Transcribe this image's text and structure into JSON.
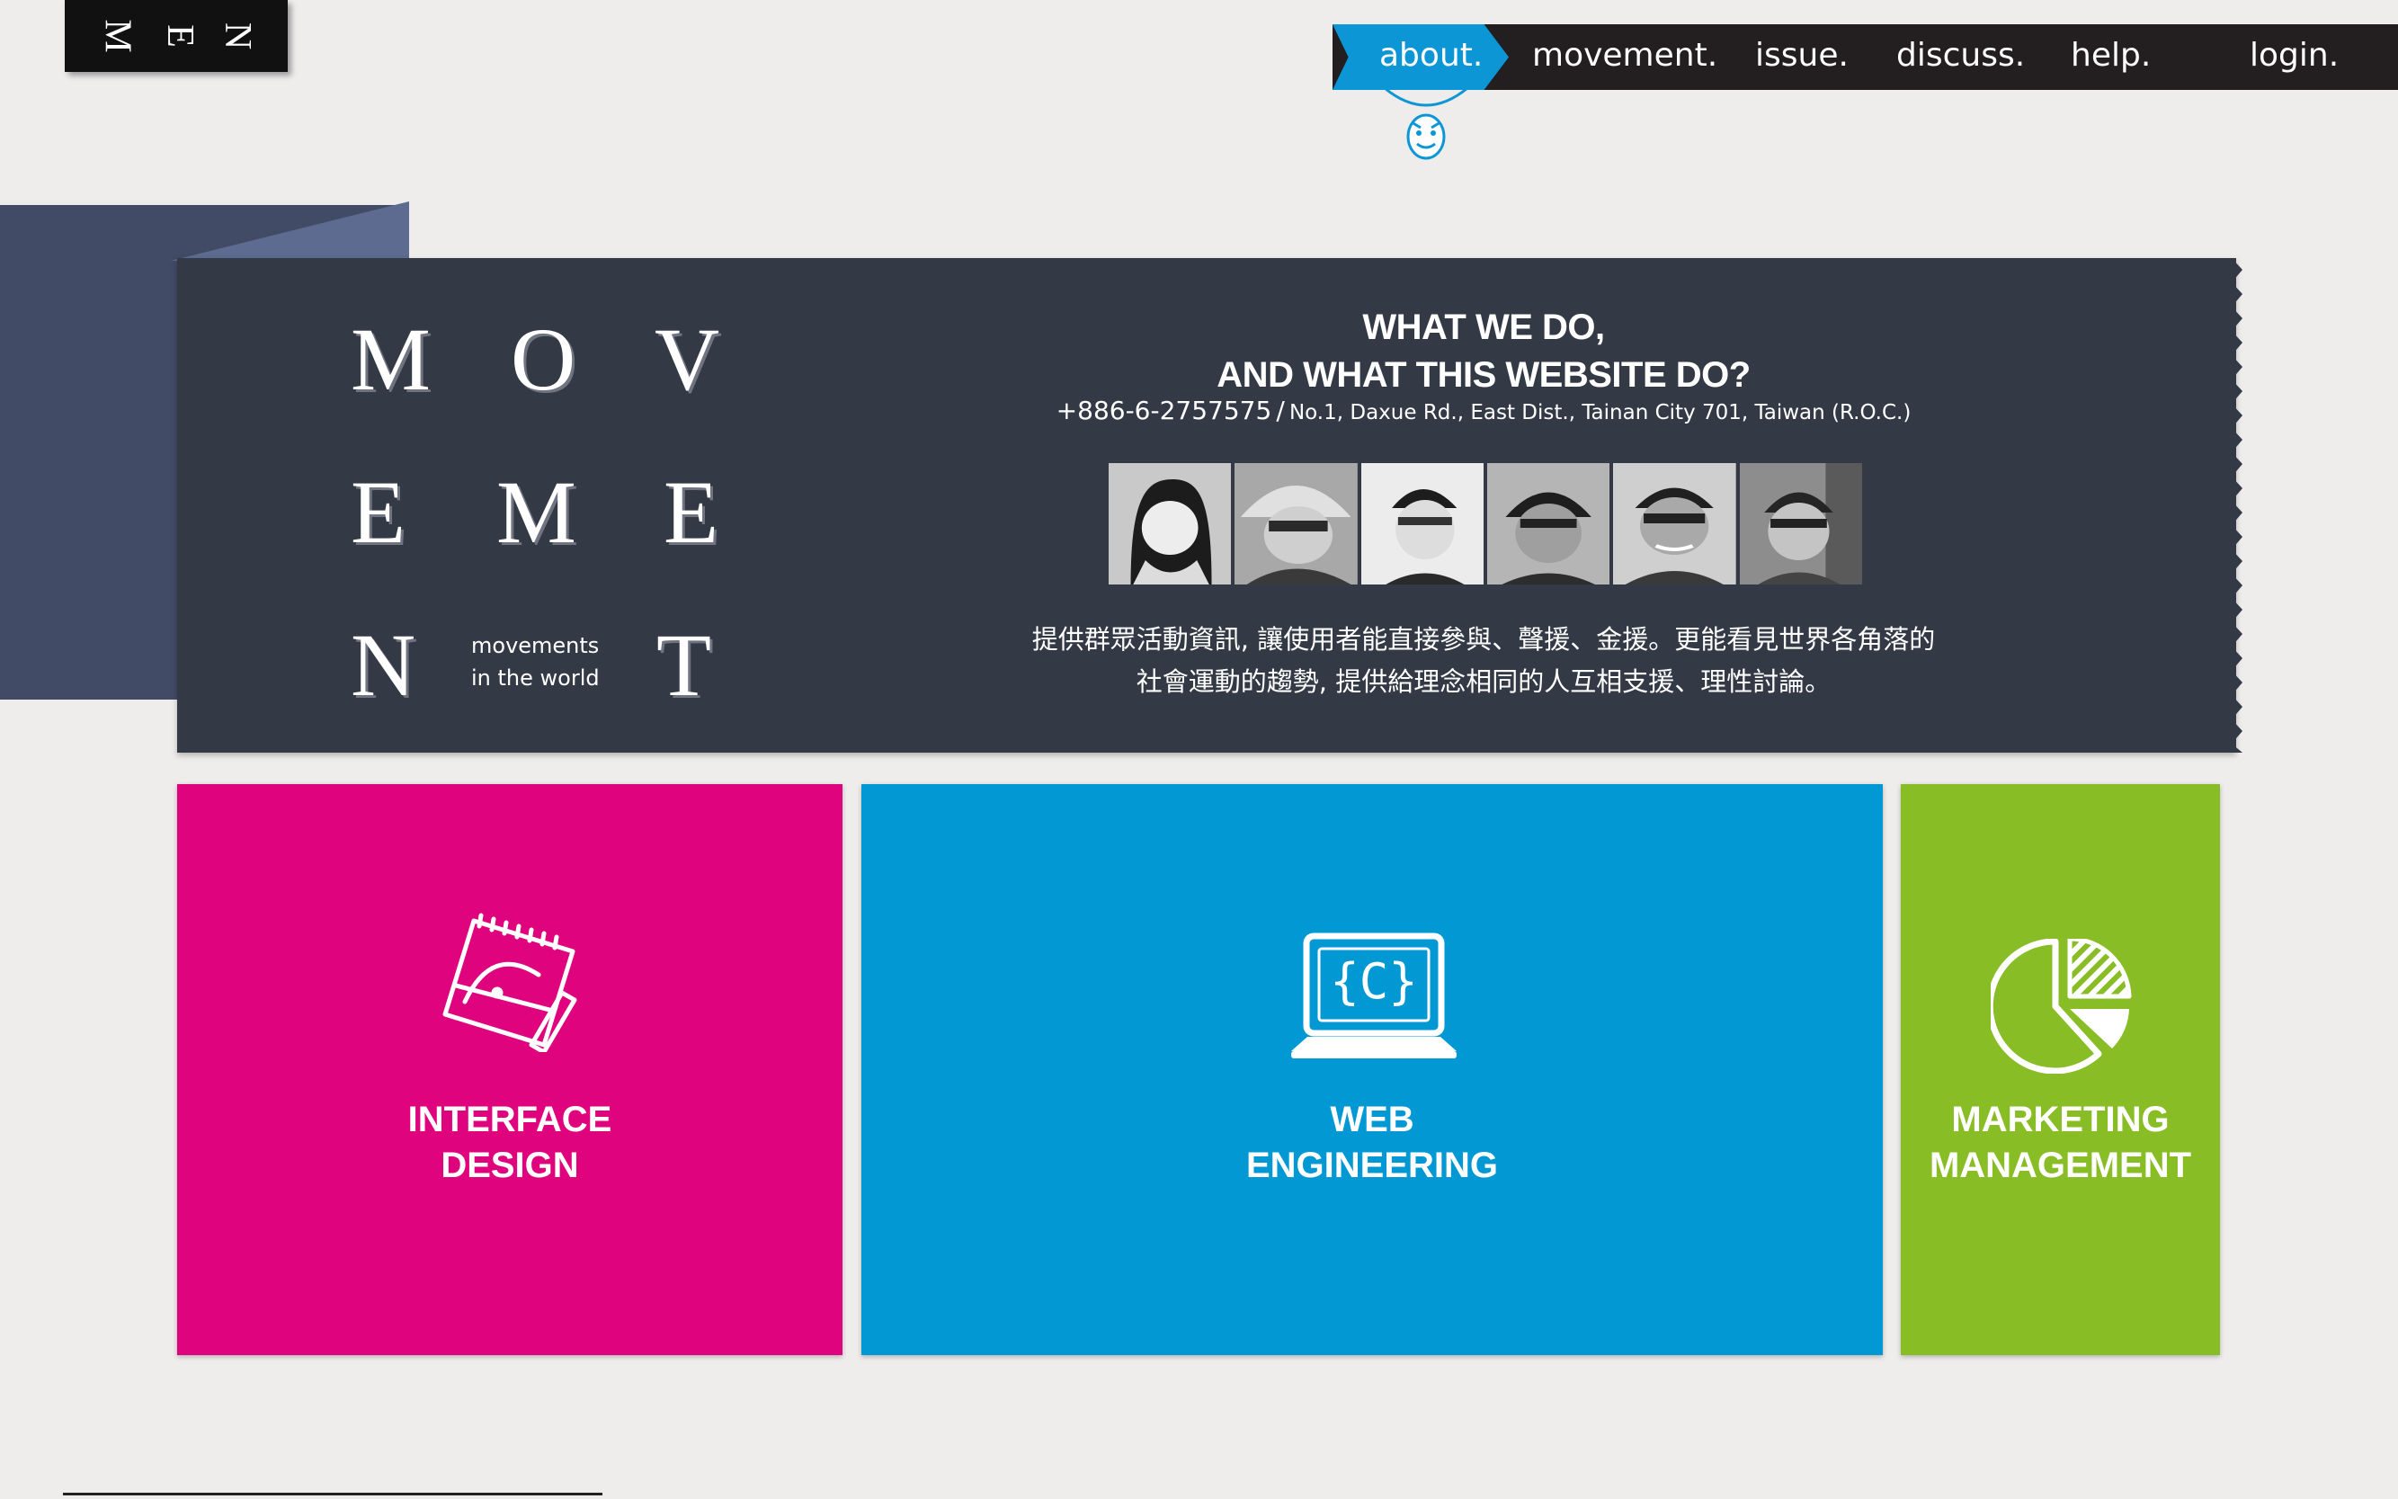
{
  "logo": {
    "letters": [
      "M",
      "E",
      "N"
    ]
  },
  "nav": {
    "items": [
      {
        "label": "about.",
        "active": true
      },
      {
        "label": "movement."
      },
      {
        "label": "issue."
      },
      {
        "label": "discuss."
      },
      {
        "label": "help."
      },
      {
        "label": "login."
      }
    ],
    "active_color": "#0d96d6",
    "bar_color": "#231f20"
  },
  "hero": {
    "letters": [
      "M",
      "O",
      "V",
      "E",
      "M",
      "E",
      "N",
      "T"
    ],
    "tagline": [
      "movements",
      "in the world"
    ],
    "heading": [
      "WHAT WE DO,",
      "AND WHAT THIS WEBSITE DO?"
    ],
    "phone": "+886-6-2757575",
    "separator": "/",
    "address": "No.1, Daxue Rd., East Dist., Tainan City 701, Taiwan (R.O.C.)",
    "description": [
      "提供群眾活動資訊, 讓使用者能直接參與、聲援、金援。更能看見世界各角落的",
      "社會運動的趨勢, 提供給理念相同的人互相支援、理性討論。"
    ],
    "photo_count": 6
  },
  "tiles": [
    {
      "title": [
        "INTERFACE",
        "DESIGN"
      ],
      "icon": "design-notebook-icon",
      "color": "#e0037e"
    },
    {
      "title": [
        "WEB",
        "ENGINEERING"
      ],
      "icon": "laptop-code-icon",
      "color": "#0298d4"
    },
    {
      "title": [
        "MARKETING",
        "MANAGEMENT"
      ],
      "icon": "pie-chart-icon",
      "color": "#88bd26"
    }
  ]
}
